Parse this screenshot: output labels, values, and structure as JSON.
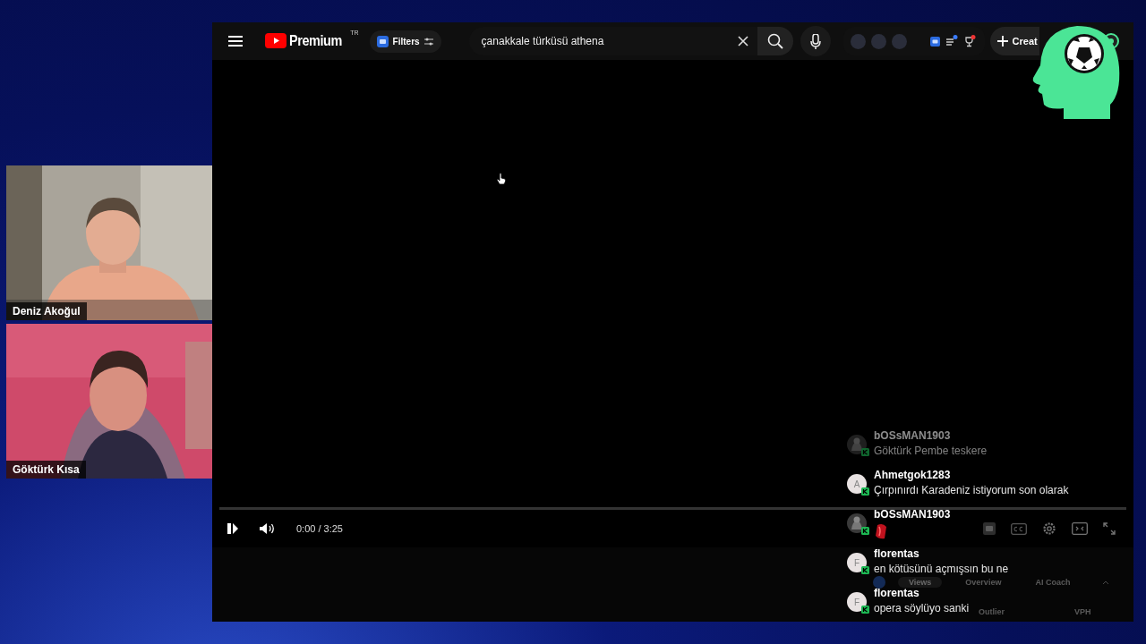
{
  "participants": [
    {
      "name": "Deniz Akoğul"
    },
    {
      "name": "Göktürk Kısa"
    }
  ],
  "header": {
    "logo_text": "Premium",
    "region": "TR",
    "filters_label": "Filters",
    "search": {
      "value": "çanakkale türküsü athena"
    },
    "create_label": "Creat",
    "notifications": [
      {
        "kind": "list",
        "badge": true
      },
      {
        "kind": "trophy",
        "badge": true
      }
    ]
  },
  "player": {
    "playing": true,
    "time": "0:00 / 3:25",
    "progress": {
      "level": 0
    },
    "cc_enabled": false
  },
  "analytics_tabs": [
    {
      "label": "Views",
      "selected": true
    },
    {
      "label": "Overview",
      "selected": false
    },
    {
      "label": "AI Coach",
      "selected": false
    }
  ],
  "analytics_columns": [
    "Outlier",
    "VPH"
  ],
  "chat": [
    {
      "author": "bOSsMAN1903",
      "message": {
        "kind": "text",
        "text": "Göktürk Pembe teskere"
      },
      "dimmed": true
    },
    {
      "author": "Ahmetgok1283",
      "avatar": {
        "kind": "letter",
        "letter": "A"
      },
      "message": {
        "kind": "text",
        "text": "Çırpınırdı Karadeniz istiyorum son olarak"
      },
      "dimmed": false
    },
    {
      "author": "bOSsMAN1903",
      "message": {
        "kind": "emoji"
      },
      "dimmed": false
    },
    {
      "author": "florentas",
      "avatar": {
        "kind": "letter",
        "letter": "F"
      },
      "message": {
        "kind": "text",
        "text": "en kötüsünü açmışsın bu ne"
      },
      "dimmed": false
    },
    {
      "author": "florentas",
      "avatar": {
        "kind": "letter",
        "letter": "F"
      },
      "message": {
        "kind": "text",
        "text": "opera söylüyo sanki"
      },
      "dimmed": false
    }
  ]
}
